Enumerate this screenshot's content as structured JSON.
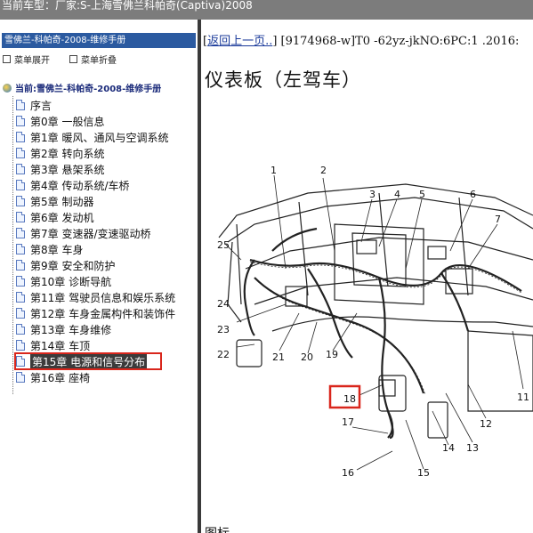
{
  "header": {
    "vehicle_line": "当前车型：厂家:S-上海雪佛兰科帕奇(Captiva)2008"
  },
  "sidebar": {
    "title": "雪佛兰-科帕奇-2008-维修手册",
    "expand_label": "菜单展开",
    "collapse_label": "菜单折叠",
    "root_label": "当前:雪佛兰-科帕奇-2008-维修手册",
    "items": [
      {
        "label": "序言"
      },
      {
        "label": "第0章 一般信息"
      },
      {
        "label": "第1章 暖风、通风与空调系统"
      },
      {
        "label": "第2章 转向系统"
      },
      {
        "label": "第3章 悬架系统"
      },
      {
        "label": "第4章 传动系统/车桥"
      },
      {
        "label": "第5章 制动器"
      },
      {
        "label": "第6章 发动机"
      },
      {
        "label": "第7章 变速器/变速驱动桥"
      },
      {
        "label": "第8章 车身"
      },
      {
        "label": "第9章 安全和防护"
      },
      {
        "label": "第10章 诊断导航"
      },
      {
        "label": "第11章 驾驶员信息和娱乐系统"
      },
      {
        "label": "第12章 车身金属构件和装饰件"
      },
      {
        "label": "第13章 车身维修"
      },
      {
        "label": "第14章 车顶"
      },
      {
        "label": "第15章 电源和信号分布",
        "highlighted": true
      },
      {
        "label": "第16章 座椅"
      }
    ]
  },
  "content": {
    "back_link": "返回上一页..",
    "doc_info": "] [9174968-w]T0 -62yz-jkNO:6PC:1 .2016:",
    "bracket_open": "[",
    "title": "仪表板（左驾车）",
    "figure_caption": "图标",
    "callouts": [
      "1",
      "2",
      "3",
      "4",
      "5",
      "6",
      "7",
      "11",
      "12",
      "13",
      "14",
      "15",
      "16",
      "17",
      "18",
      "19",
      "20",
      "21",
      "22",
      "23",
      "24",
      "25"
    ],
    "highlighted_callout": "18",
    "highlight_color": "#d9261c"
  }
}
